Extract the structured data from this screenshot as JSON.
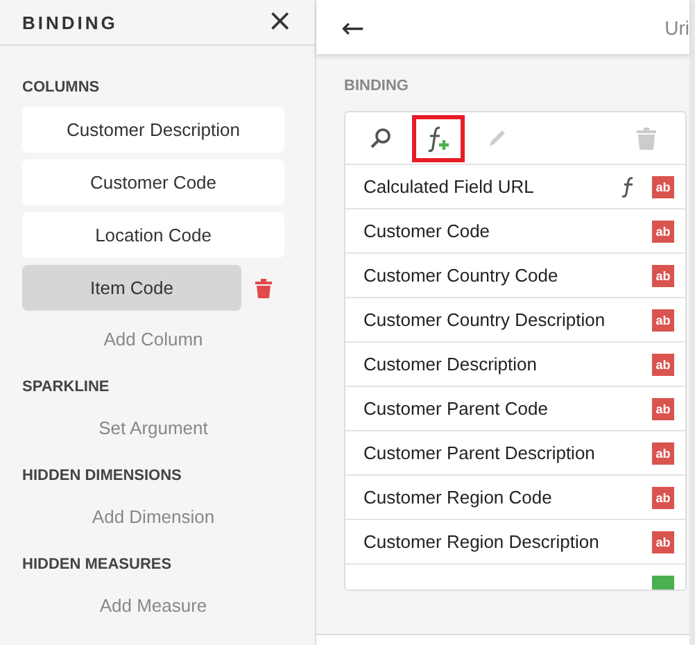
{
  "left_panel": {
    "title": "BINDING",
    "close_label": "×",
    "sections": [
      {
        "title": "COLUMNS",
        "items": [
          {
            "label": "Customer Description",
            "selected": false
          },
          {
            "label": "Customer Code",
            "selected": false
          },
          {
            "label": "Location Code",
            "selected": false
          },
          {
            "label": "Item Code",
            "selected": true
          }
        ],
        "add_label": "Add Column"
      },
      {
        "title": "SPARKLINE",
        "add_label": "Set Argument"
      },
      {
        "title": "HIDDEN DIMENSIONS",
        "add_label": "Add Dimension"
      },
      {
        "title": "HIDDEN MEASURES",
        "add_label": "Add Measure"
      }
    ]
  },
  "right_panel": {
    "back_label": "←",
    "header_text": "Uri",
    "section_title": "BINDING",
    "toolbar": [
      {
        "kind": "search",
        "disabled": false,
        "highlighted": false
      },
      {
        "kind": "add-calculated",
        "disabled": false,
        "highlighted": true
      },
      {
        "kind": "edit",
        "disabled": true,
        "highlighted": false
      },
      {
        "kind": "delete",
        "disabled": true,
        "highlighted": false
      }
    ],
    "fields": [
      {
        "name": "Calculated Field URL",
        "calculated": true,
        "kind": "text",
        "type_badge": "ab"
      },
      {
        "name": "Customer Code",
        "calculated": false,
        "kind": "text",
        "type_badge": "ab"
      },
      {
        "name": "Customer Country Code",
        "calculated": false,
        "kind": "text",
        "type_badge": "ab"
      },
      {
        "name": "Customer Country Description",
        "calculated": false,
        "kind": "text",
        "type_badge": "ab"
      },
      {
        "name": "Customer Description",
        "calculated": false,
        "kind": "text",
        "type_badge": "ab"
      },
      {
        "name": "Customer Parent Code",
        "calculated": false,
        "kind": "text",
        "type_badge": "ab"
      },
      {
        "name": "Customer Parent Description",
        "calculated": false,
        "kind": "text",
        "type_badge": "ab"
      },
      {
        "name": "Customer Region Code",
        "calculated": false,
        "kind": "text",
        "type_badge": "ab"
      },
      {
        "name": "Customer Region Description",
        "calculated": false,
        "kind": "text",
        "type_badge": "ab"
      },
      {
        "calculated": false,
        "kind": "date"
      }
    ]
  }
}
